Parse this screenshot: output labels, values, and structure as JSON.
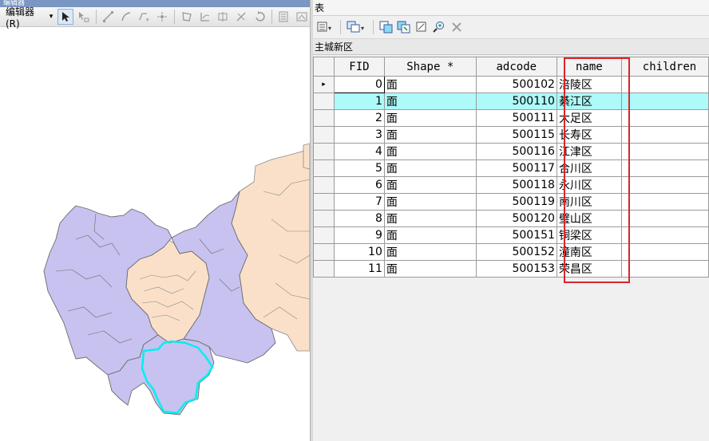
{
  "editor": {
    "title": "编辑器",
    "menu_label": "编辑器(R)",
    "menu_arrow": "▾"
  },
  "table_window": {
    "title": "表",
    "layer_tab": "主城新区"
  },
  "table": {
    "columns": [
      "FID",
      "Shape *",
      "adcode",
      "name",
      "children"
    ],
    "rows": [
      {
        "fid": "0",
        "shape": "面",
        "adcode": "500102",
        "name": "涪陵区"
      },
      {
        "fid": "1",
        "shape": "面",
        "adcode": "500110",
        "name": "綦江区"
      },
      {
        "fid": "2",
        "shape": "面",
        "adcode": "500111",
        "name": "大足区"
      },
      {
        "fid": "3",
        "shape": "面",
        "adcode": "500115",
        "name": "长寿区"
      },
      {
        "fid": "4",
        "shape": "面",
        "adcode": "500116",
        "name": "江津区"
      },
      {
        "fid": "5",
        "shape": "面",
        "adcode": "500117",
        "name": "合川区"
      },
      {
        "fid": "6",
        "shape": "面",
        "adcode": "500118",
        "name": "永川区"
      },
      {
        "fid": "7",
        "shape": "面",
        "adcode": "500119",
        "name": "南川区"
      },
      {
        "fid": "8",
        "shape": "面",
        "adcode": "500120",
        "name": "璧山区"
      },
      {
        "fid": "9",
        "shape": "面",
        "adcode": "500151",
        "name": "铜梁区"
      },
      {
        "fid": "10",
        "shape": "面",
        "adcode": "500152",
        "name": "潼南区"
      },
      {
        "fid": "11",
        "shape": "面",
        "adcode": "500153",
        "name": "荣昌区"
      }
    ],
    "current_row_marker": "▸",
    "highlighted_row_index": 1
  },
  "colors": {
    "region_fill": "#c7c2ef",
    "other_fill": "#fae0c8",
    "selection_outline": "#00f0f0",
    "row_highlight": "#aef9f9",
    "annotation_box": "#d9262c"
  },
  "icons": {
    "editor_toolbar": [
      "edit-tool-icon",
      "edit-annotation-tool-icon",
      "straight-segment-icon",
      "arc-segment-icon",
      "point-tool-icon",
      "midpoint-icon",
      "edit-vertices-icon",
      "reshape-icon",
      "cut-polygon-icon",
      "split-icon",
      "rotate-icon",
      "attributes-icon",
      "sketch-properties-icon"
    ],
    "table_toolbar": [
      "table-options-icon",
      "related-tables-icon",
      "select-by-attributes-icon",
      "switch-selection-icon",
      "clear-selection-icon",
      "zoom-to-selected-icon",
      "delete-selected-icon"
    ]
  }
}
